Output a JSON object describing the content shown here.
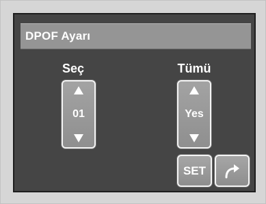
{
  "window": {
    "title": "DPOF Ayarı"
  },
  "select_column": {
    "label": "Seç",
    "value": "01"
  },
  "all_column": {
    "label": "Tümü",
    "value": "Yes"
  },
  "buttons": {
    "set_label": "SET",
    "back_icon": "return-arrow-icon"
  },
  "colors": {
    "frame": "#d6d6d6",
    "screen": "#454545",
    "title_bar": "#959595",
    "button": "#9a9a9a",
    "text": "#ffffff"
  }
}
